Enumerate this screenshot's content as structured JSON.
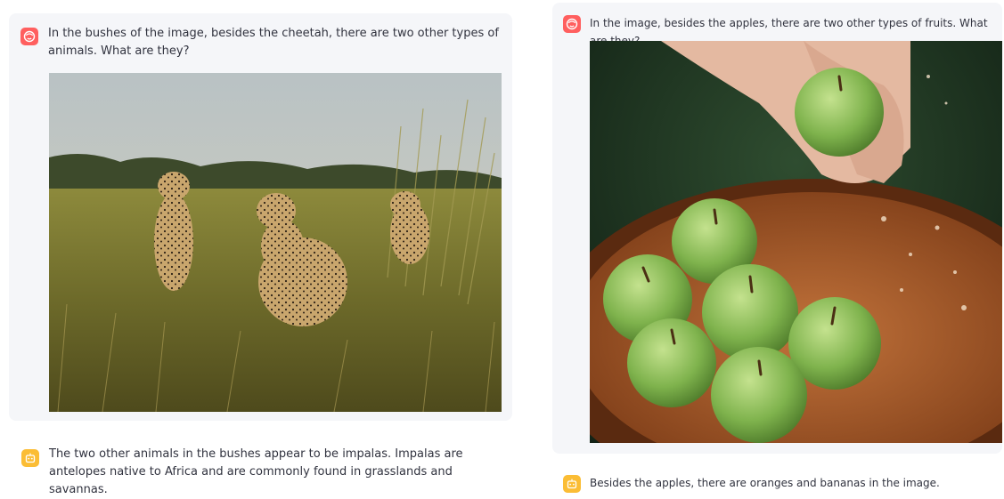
{
  "left": {
    "question": "In the bushes of the image, besides the cheetah, there are two other types of animals. What are they?",
    "answer": "The two other animals in the bushes appear to be impalas. Impalas are antelopes native to Africa and are commonly found in grasslands and savannas."
  },
  "right": {
    "question": "In the image, besides the apples, there are two other types of fruits. What are they?",
    "answer": "Besides the apples, there are oranges and bananas in the image."
  },
  "icons": {
    "user": "user-face-icon",
    "bot": "robot-face-icon"
  },
  "colors": {
    "user_avatar": "#ff5f5f",
    "bot_avatar": "#fbbd35",
    "card_bg": "#f5f6f9",
    "text": "#31333f"
  }
}
